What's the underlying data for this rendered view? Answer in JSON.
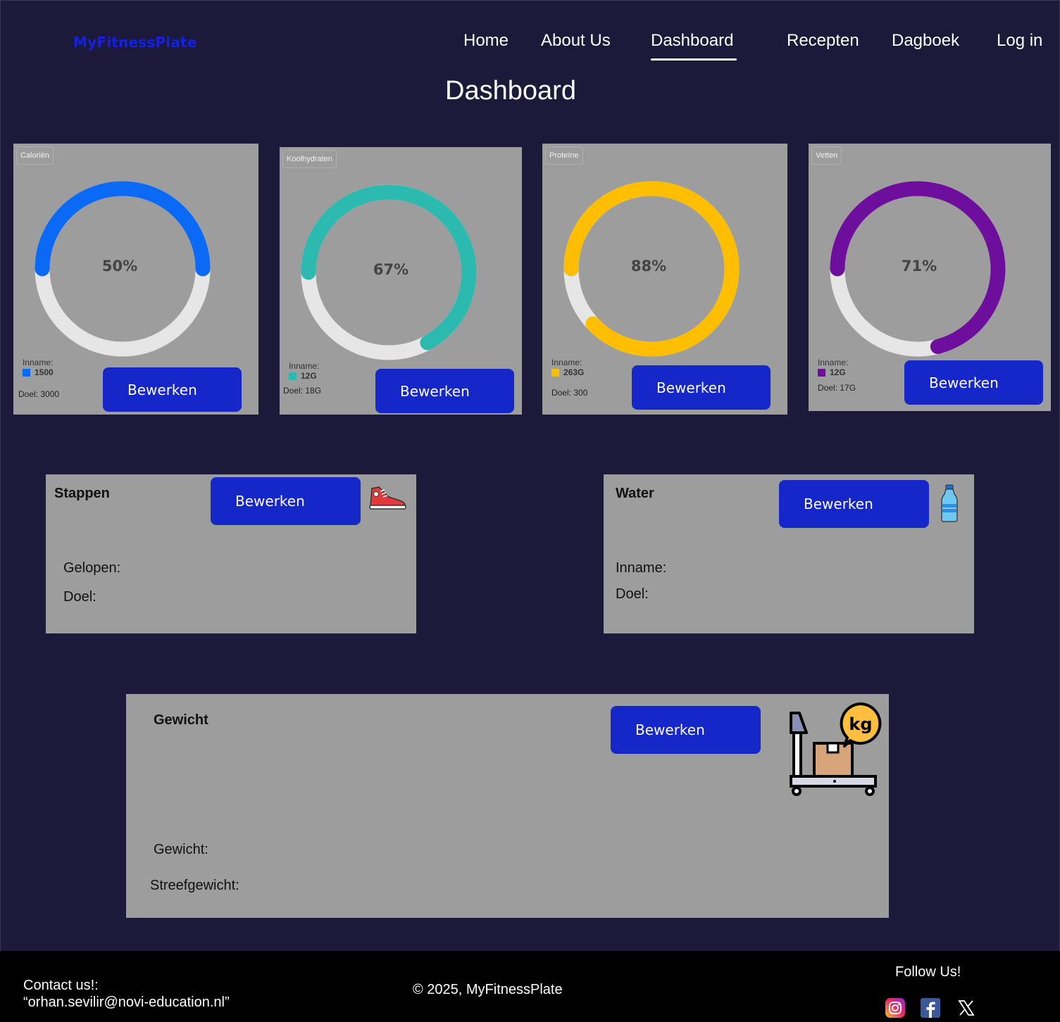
{
  "brand": "MyFitnessPlate",
  "nav": [
    {
      "label": "Home"
    },
    {
      "label": "About Us"
    },
    {
      "label": "Dashboard",
      "active": true
    },
    {
      "label": "Recepten"
    },
    {
      "label": "Dagboek"
    },
    {
      "label": "Log in"
    }
  ],
  "page_title": "Dashboard",
  "colors": {
    "background": "#1d193a",
    "card": "#9d9d9d",
    "button": "#1527c9",
    "brand": "#1320e6",
    "ring_track": "#e6e6e6"
  },
  "macros": [
    {
      "chip": "Caloriën",
      "percent_label": "50%",
      "progress": 0.5,
      "color": "#0a6af5",
      "legend_title": "Inname:",
      "intake": "1500",
      "goal": "Doel: 3000",
      "button": "Bewerken"
    },
    {
      "chip": "Koolhydraten",
      "percent_label": "67%",
      "progress": 0.67,
      "color": "#2cbab0",
      "legend_title": "Inname:",
      "intake": "12G",
      "goal": "Doel: 18G",
      "button": "Bewerken"
    },
    {
      "chip": "Proteïne",
      "percent_label": "88%",
      "progress": 0.88,
      "color": "#ffbe00",
      "legend_title": "Inname:",
      "intake": "263G",
      "goal": "Doel: 300",
      "button": "Bewerken"
    },
    {
      "chip": "Vetten",
      "percent_label": "71%",
      "progress": 0.71,
      "color": "#6d0f9c",
      "legend_title": "Inname:",
      "intake": "12G",
      "goal": "Doel: 17G",
      "button": "Bewerken"
    }
  ],
  "steps": {
    "title": "Stappen",
    "button": "Bewerken",
    "walked": "Gelopen:",
    "goal": "Doel:",
    "icon": "sneaker-icon"
  },
  "water": {
    "title": "Water",
    "button": "Bewerken",
    "intake": "Inname:",
    "goal": "Doel:",
    "icon": "water-bottle-icon"
  },
  "weight": {
    "title": "Gewicht",
    "button": "Bewerken",
    "weight": "Gewicht:",
    "target": "Streefgewicht:",
    "icon": "weighing-scale-icon",
    "icon_text": "kg"
  },
  "footer": {
    "contact_line1": "Contact us!:",
    "contact_line2": "“orhan.sevilir@novi-education.nl”",
    "copyright": "© 2025, MyFitnessPlate",
    "follow": "Follow Us!",
    "social": [
      "instagram-icon",
      "facebook-icon",
      "x-icon"
    ]
  }
}
